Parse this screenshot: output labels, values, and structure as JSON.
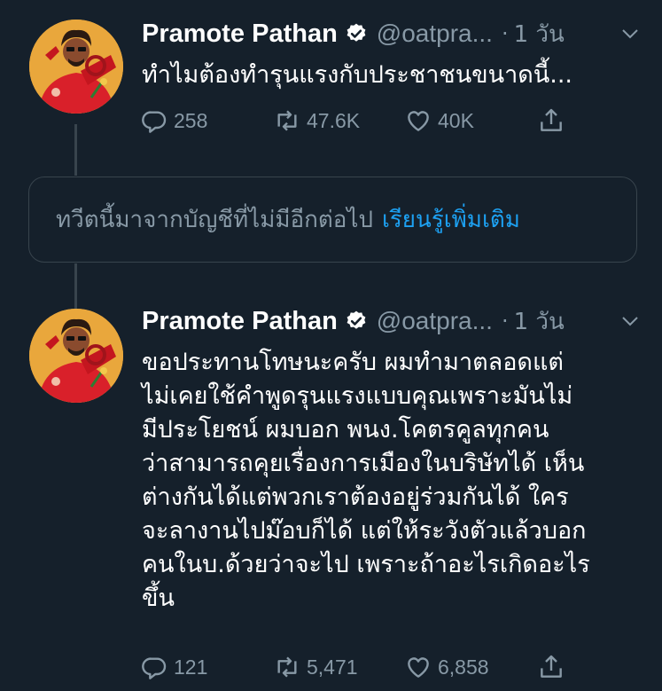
{
  "colors": {
    "background": "#15202b",
    "secondary_text": "#8899a6",
    "link": "#1da1f2",
    "divider": "#38444d"
  },
  "tweet1": {
    "name": "Pramote Pathan",
    "handle": "@oatpra...",
    "dot": "·",
    "time": "1 วัน",
    "text": "ทำไมต้องทำรุนแรงกับประชาชนขนาดนี้...",
    "replies": "258",
    "retweets": "47.6K",
    "likes": "40K"
  },
  "notice": {
    "text": "ทวีตนี้มาจากบัญชีที่ไม่มีอีกต่อไป",
    "link": "เรียนรู้เพิ่มเติม"
  },
  "tweet2": {
    "name": "Pramote Pathan",
    "handle": "@oatpra...",
    "dot": "·",
    "time": "1 วัน",
    "text": "ขอประทานโทษนะครับ ผมทำมาตลอดแต่\nไม่เคยใช้คำพูดรุนแรงแบบคุณเพราะมันไม่\nมีประโยชน์ ผมบอก พนง.โคตรคูลทุกคน\nว่าสามารถคุยเรื่องการเมืองในบริษัทได้ เห็น\nต่างกันได้แต่พวกเราต้องอยู่ร่วมกันได้ ใคร\nจะลางานไปม๊อบก็ได้ แต่ให้ระวังตัวแล้วบอก\nคนในบ.ด้วยว่าจะไป เพราะถ้าอะไรเกิดอะไร\nขึ้น",
    "replies": "121",
    "retweets": "5,471",
    "likes": "6,858"
  },
  "icons": {
    "verified": "verified-badge-icon",
    "chevron": "chevron-down-icon",
    "reply": "reply-icon",
    "retweet": "retweet-icon",
    "like": "heart-icon",
    "share": "share-icon"
  }
}
